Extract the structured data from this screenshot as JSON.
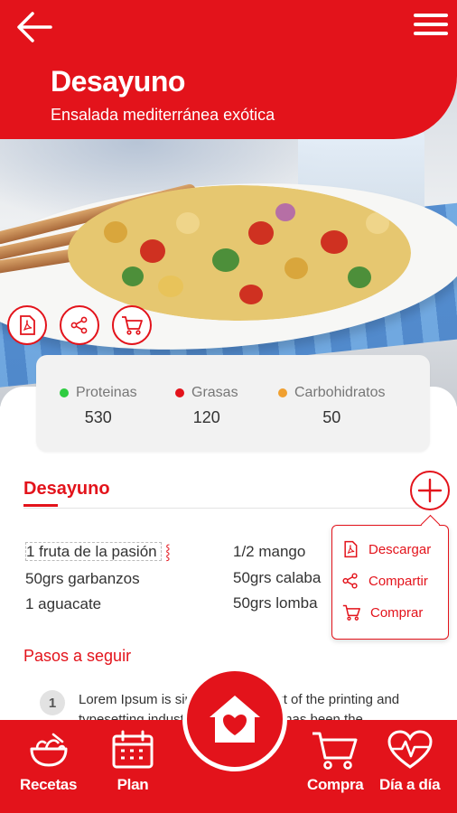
{
  "header": {
    "title": "Desayuno",
    "subtitle": "Ensalada mediterránea exótica"
  },
  "nutrition": [
    {
      "label": "Proteinas",
      "value": "530",
      "color": "#2ecc40"
    },
    {
      "label": "Grasas",
      "value": "120",
      "color": "#e3131b"
    },
    {
      "label": "Carbohidratos",
      "value": "50",
      "color": "#f0a030"
    }
  ],
  "section": {
    "title": "Desayuno"
  },
  "ingredients": {
    "col1": [
      "1 fruta de la pasión",
      "50grs garbanzos",
      "1 aguacate"
    ],
    "col2": [
      "1/2 mango",
      "50grs calaba",
      "50grs lomba"
    ]
  },
  "dropdown": {
    "items": [
      {
        "label": "Descargar",
        "icon": "pdf-icon"
      },
      {
        "label": "Compartir",
        "icon": "share-icon"
      },
      {
        "label": "Comprar",
        "icon": "cart-icon"
      }
    ]
  },
  "steps": {
    "title": "Pasos a seguir",
    "items": [
      {
        "number": "1",
        "text": "Lorem Ipsum is simply dummy text of the printing and typesetting industry. Lorem Ipsum has been the"
      }
    ]
  },
  "bottom_nav": {
    "recetas": "Recetas",
    "plan": "Plan",
    "compra": "Compra",
    "dia": "Día a día"
  },
  "colors": {
    "brand": "#e3131b",
    "panel": "#f2f2f2"
  }
}
